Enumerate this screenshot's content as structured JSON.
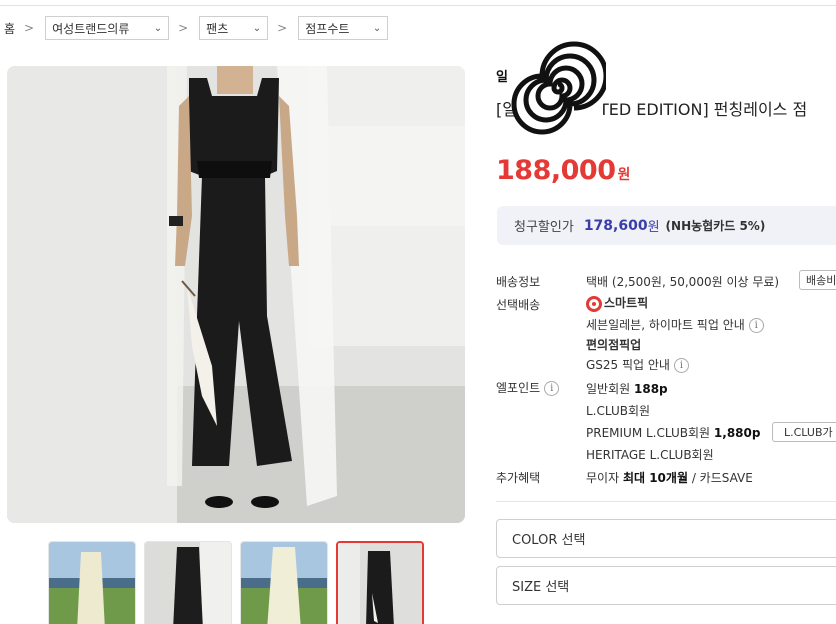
{
  "breadcrumb": {
    "home": "홈",
    "separator": ">",
    "category1": "여성트랜드의류",
    "category2": "팬츠",
    "category3": "점프수트"
  },
  "product": {
    "brand": "일",
    "title_start": "[일",
    "title_end": "TED EDITION] 펀칭레이스 점",
    "price": "188,000",
    "price_unit": "원"
  },
  "discount": {
    "label": "청구할인가",
    "price": "178,600",
    "unit": "원",
    "card": "(NH농협카드 5%)"
  },
  "shipping": {
    "label": "배송정보",
    "value": "택배 (2,500원, 50,000원 이상 무료)",
    "button": "배송비"
  },
  "pickup": {
    "label": "선택배송",
    "smartpick": "스마트픽",
    "smartpick_desc": "세븐일레븐, 하이마트 픽업 안내",
    "convenience": "편의점픽업",
    "convenience_desc": "GS25 픽업 안내"
  },
  "points": {
    "label": "엘포인트",
    "general_label": "일반회원",
    "general_value": "188p",
    "lclub": "L.CLUB회원",
    "premium_label": "PREMIUM L.CLUB회원",
    "premium_value": "1,880p",
    "premium_button": "L.CLUB가",
    "heritage": "HERITAGE L.CLUB회원"
  },
  "extra": {
    "label": "추가혜택",
    "prefix": "무이자",
    "bold": "최대 10개월",
    "suffix": "/ 카드SAVE"
  },
  "options": {
    "color": "COLOR 선택",
    "size": "SIZE 선택"
  },
  "icons": {
    "info": "i",
    "chevron": "⌄"
  },
  "colors": {
    "price_red": "#e53935",
    "discount_purple": "#3b3ea8"
  }
}
